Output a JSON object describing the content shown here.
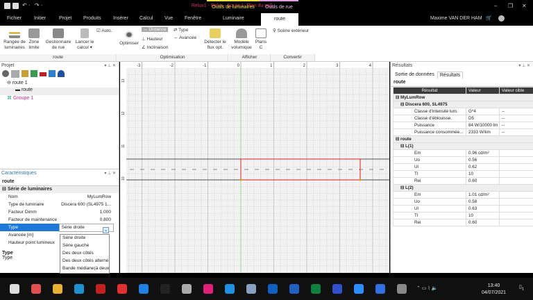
{
  "titlebar": {
    "title": "Relux1 - Relux - [route 1: Plan du sol]",
    "context_tab_1": "Outils de luminaires",
    "context_tab_2": "Outils de rue",
    "minimize": "–",
    "restore": "❐",
    "close": "✕"
  },
  "menu": {
    "tabs": [
      "Fichier",
      "Initier",
      "Projet",
      "Produits",
      "Insérer",
      "Calcul",
      "Vue",
      "Fenêtre",
      "Luminaire",
      "route"
    ],
    "active": "route",
    "user": "Maxime VAN DER HAM"
  },
  "ribbon": {
    "route_group": {
      "label": "route",
      "rangee": "Rangée de luminaires",
      "zone": "Zone limite",
      "gestionnaire": "Gestionnaire de rue",
      "lancer": "Lancer le calcul ▾",
      "auto": "Auto.",
      "auto_checked": true
    },
    "optimisation_group": {
      "label": "Optimisation",
      "optimiser": "Optimiser",
      "distance": "Distance",
      "hauteur": "Hauteur",
      "inclinaison": "Inclinaison",
      "type": "Type",
      "avancee": "Avancée",
      "detecter": "Détecter le flux opt."
    },
    "afficher_group": {
      "label": "Afficher",
      "modele": "Modèle volumique",
      "plans": "Plans C"
    },
    "convertir_group": {
      "label": "Convertir",
      "scene": "Scène extérieur"
    }
  },
  "projet": {
    "title": "Projet",
    "tree": [
      {
        "label": "route 1",
        "level": 0
      },
      {
        "label": "route",
        "level": 1
      },
      {
        "label": "Groupe 1",
        "level": 0,
        "color": "#e0208c"
      }
    ]
  },
  "caracteristiques": {
    "title": "Caractéristiques",
    "tab": "route",
    "section": "Série de luminaires",
    "rows": [
      {
        "name": "Nom",
        "value": "MyLumRow"
      },
      {
        "name": "Type de luminaire",
        "value": "Discera 600 (SL4975 1..."
      },
      {
        "name": "Facteur Dimm",
        "value": "1.000"
      },
      {
        "name": "Facteur de maintenance",
        "value": "0.800"
      },
      {
        "name": "Type",
        "value": "Série droite"
      },
      {
        "name": "Avancée [m]",
        "value": ""
      },
      {
        "name": "Hauteur point lumineux",
        "value": ""
      }
    ],
    "dropdown_options": [
      "Série droite",
      "Série gauche",
      "Des deux côtés",
      "Des deux côtés alterné",
      "Bande médiane(à deux"
    ],
    "help_title": "Type",
    "help_text": "Type"
  },
  "canvas": {
    "ruler_x": [
      "-3",
      "-2",
      "-1",
      "0",
      "1",
      "2",
      "3",
      "4"
    ],
    "ruler_y": [
      "13",
      "12",
      "11",
      "10"
    ]
  },
  "resultats": {
    "title": "Résultats",
    "tabs": [
      "Sortie de données",
      "Résultats"
    ],
    "active_tab": "Résultats",
    "subtab": "route",
    "columns": [
      "Résultat",
      "Valeur",
      "Valeur cible"
    ],
    "groups": [
      {
        "label": "MyLumRow",
        "sub": [
          {
            "label": "Discera 600, SL4975",
            "rows": [
              [
                "Classe d'intensité lum.",
                "G*4",
                "--"
              ],
              [
                "Classe d'éblouisse.",
                "D5",
                "--"
              ],
              [
                "Puissance",
                "84 W/10000 lm",
                "--"
              ],
              [
                "Puissance consommée...",
                "2333 W/km",
                "--"
              ]
            ]
          }
        ]
      },
      {
        "label": "route",
        "sub": [
          {
            "label": "L(1)",
            "rows": [
              [
                "Em",
                "0.96 cd/m²",
                ""
              ],
              [
                "Uo",
                "0.56",
                ""
              ],
              [
                "Ul",
                "0.62",
                ""
              ],
              [
                "TI",
                "10",
                ""
              ],
              [
                "Rei",
                "0.60",
                ""
              ]
            ]
          },
          {
            "label": "L(2)",
            "rows": [
              [
                "Em",
                "1.01 cd/m²",
                ""
              ],
              [
                "Uo",
                "0.58",
                ""
              ],
              [
                "Ul",
                "0.63",
                ""
              ],
              [
                "TI",
                "10",
                ""
              ],
              [
                "Rei",
                "0.60",
                ""
              ]
            ]
          }
        ]
      }
    ]
  },
  "taskbar": {
    "time": "13:40",
    "date": "04/07/2021",
    "notification_count": "1"
  }
}
